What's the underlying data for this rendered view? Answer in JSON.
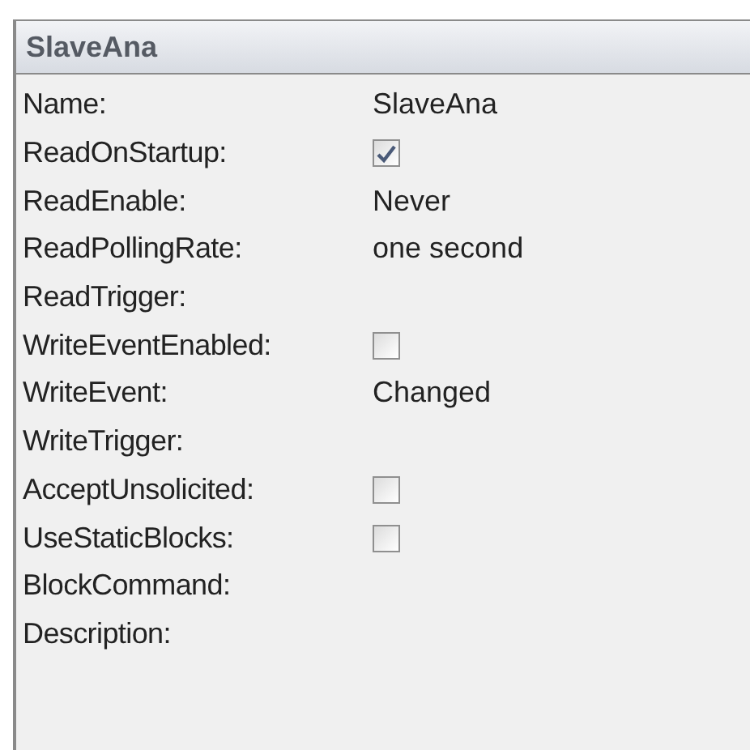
{
  "panel": {
    "title": "SlaveAna"
  },
  "properties": [
    {
      "label": "Name:",
      "kind": "text",
      "value": "SlaveAna"
    },
    {
      "label": "ReadOnStartup:",
      "kind": "checkbox",
      "checked": true
    },
    {
      "label": "ReadEnable:",
      "kind": "text",
      "value": "Never"
    },
    {
      "label": "ReadPollingRate:",
      "kind": "text",
      "value": "one second"
    },
    {
      "label": "ReadTrigger:",
      "kind": "empty"
    },
    {
      "label": "WriteEventEnabled:",
      "kind": "checkbox",
      "checked": false
    },
    {
      "label": "WriteEvent:",
      "kind": "text",
      "value": "Changed"
    },
    {
      "label": "WriteTrigger:",
      "kind": "empty"
    },
    {
      "label": "AcceptUnsolicited:",
      "kind": "checkbox",
      "checked": false
    },
    {
      "label": "UseStaticBlocks:",
      "kind": "checkbox",
      "checked": false
    },
    {
      "label": "BlockCommand:",
      "kind": "empty"
    },
    {
      "label": "Description:",
      "kind": "empty"
    }
  ]
}
